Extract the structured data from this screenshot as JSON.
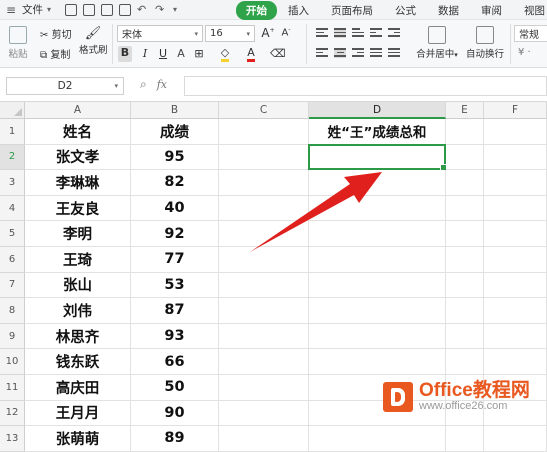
{
  "menu": {
    "file_label": "文件",
    "tabs": [
      {
        "label": "开始",
        "active": true
      },
      {
        "label": "插入"
      },
      {
        "label": "页面布局"
      },
      {
        "label": "公式"
      },
      {
        "label": "数据"
      },
      {
        "label": "审阅"
      },
      {
        "label": "视图"
      }
    ]
  },
  "ribbon": {
    "paste": "粘贴",
    "cut": "剪切",
    "copy": "复制",
    "format_painter": "格式刷",
    "font_name": "宋体",
    "font_size": "16",
    "merge_center": "合并居中",
    "wrap_text": "自动换行",
    "number_format": "常规"
  },
  "formula_bar": {
    "name_box": "D2",
    "fx": "fx",
    "value": ""
  },
  "grid": {
    "columns": [
      "A",
      "B",
      "C",
      "D",
      "E",
      "F"
    ],
    "selected_column": "D",
    "selected_row": "2",
    "rows": [
      {
        "n": "1",
        "a": "姓名",
        "b": "成绩",
        "d": "姓“王”成绩总和"
      },
      {
        "n": "2",
        "a": "张文孝",
        "b": "95",
        "d": ""
      },
      {
        "n": "3",
        "a": "李琳琳",
        "b": "82",
        "d": ""
      },
      {
        "n": "4",
        "a": "王友良",
        "b": "40",
        "d": ""
      },
      {
        "n": "5",
        "a": "李明",
        "b": "92",
        "d": ""
      },
      {
        "n": "6",
        "a": "王琦",
        "b": "77",
        "d": ""
      },
      {
        "n": "7",
        "a": "张山",
        "b": "53",
        "d": ""
      },
      {
        "n": "8",
        "a": "刘伟",
        "b": "87",
        "d": ""
      },
      {
        "n": "9",
        "a": "林思齐",
        "b": "93",
        "d": ""
      },
      {
        "n": "10",
        "a": "钱东跃",
        "b": "66",
        "d": ""
      },
      {
        "n": "11",
        "a": "高庆田",
        "b": "50",
        "d": ""
      },
      {
        "n": "12",
        "a": "王月月",
        "b": "90",
        "d": ""
      },
      {
        "n": "13",
        "a": "张萌萌",
        "b": "89",
        "d": ""
      }
    ]
  },
  "watermark": {
    "brand_latin": "Office",
    "brand_cn": "教程网",
    "url": "www.office26.com"
  },
  "colors": {
    "accent_green": "#2c9a47",
    "arrow_red": "#e0201c",
    "brand_orange": "#e8581f"
  }
}
